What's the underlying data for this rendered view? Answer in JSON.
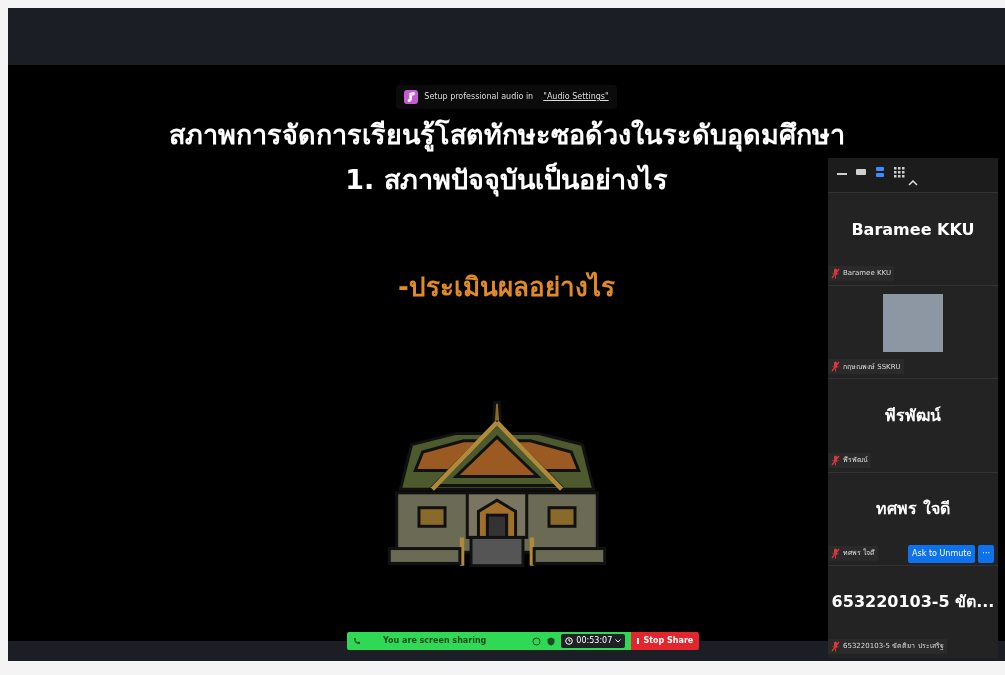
{
  "notice": {
    "text": "Setup professional audio in",
    "link": "\"Audio Settings\""
  },
  "slide": {
    "title": "สภาพการจัดการเรียนรู้โสตทักษะซอด้วงในระดับอุดมศึกษา",
    "subtitle": "1. สภาพปัจจุบันเป็นอย่างไร",
    "point": "-ประเมินผลอย่างไร"
  },
  "view_modes": [
    {
      "kind": "minimize",
      "selected": false
    },
    {
      "kind": "single",
      "selected": false
    },
    {
      "kind": "strip",
      "selected": true
    },
    {
      "kind": "grid",
      "selected": false
    }
  ],
  "participants": [
    {
      "kind": "name",
      "display": "Baramee KKU",
      "label": "Baramee KKU",
      "muted": true
    },
    {
      "kind": "video",
      "label": "กฤษณพงษ์ SSKRU",
      "muted": true
    },
    {
      "kind": "name",
      "display": "พีรพัฒน์",
      "label": "พีรพัฒน์",
      "muted": true
    },
    {
      "kind": "name",
      "display": "ทศพร ใจดี",
      "label": "ทศพร ใจดี",
      "muted": true,
      "actions": [
        "Ask to Unmute",
        "···"
      ]
    },
    {
      "kind": "name",
      "display": "653220103-5 ขัต...",
      "label": "653220103-5 ขัตติยา ประเสริฐ",
      "muted": true
    }
  ],
  "share_bar": {
    "status": "You are screen sharing",
    "timer": "00:53:07",
    "stop": "Stop Share"
  }
}
